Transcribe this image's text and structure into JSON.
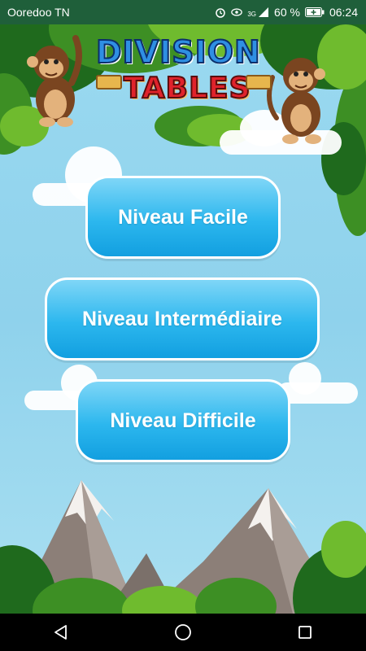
{
  "status_bar": {
    "carrier": "Ooredoo TN",
    "battery": "60 %",
    "network": "3G",
    "time": "06:24",
    "icons": [
      "alarm-icon",
      "eye-icon",
      "signal-icon",
      "battery-icon"
    ]
  },
  "logo": {
    "line1": "DIVISION",
    "line2": "TABLES"
  },
  "menu": {
    "easy_label": "Niveau Facile",
    "intermediate_label": "Niveau Intermédiaire",
    "hard_label": "Niveau Difficile"
  },
  "nav": {
    "icons": [
      "back-icon",
      "home-icon",
      "recents-icon"
    ]
  },
  "colors": {
    "button_gradient_top": "#7fd6f7",
    "button_gradient_bottom": "#129fe0",
    "sky": "#9ad9f0",
    "status_bar": "#1f5f3a"
  }
}
